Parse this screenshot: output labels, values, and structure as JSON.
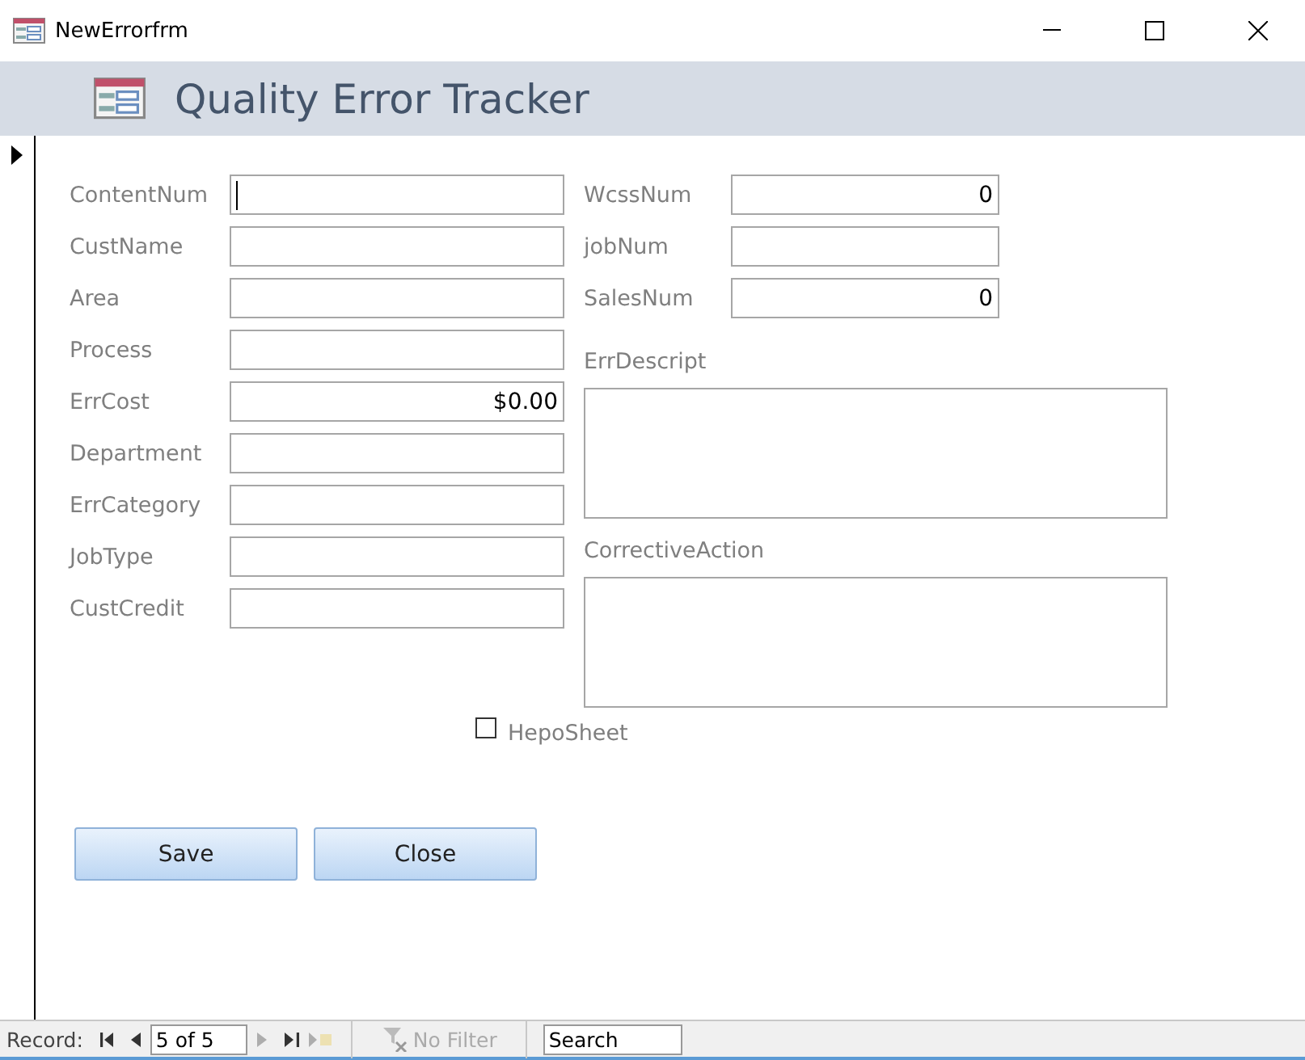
{
  "window": {
    "title": "NewErrorfrm"
  },
  "header": {
    "title": "Quality Error Tracker"
  },
  "record_selector": {
    "current": true
  },
  "left_fields": [
    {
      "label": "ContentNum",
      "kind": "text",
      "focused": true
    },
    {
      "label": "CustName",
      "kind": "text",
      "focused": false
    },
    {
      "label": "Area",
      "kind": "text",
      "focused": false
    },
    {
      "label": "Process",
      "kind": "text",
      "focused": false
    },
    {
      "label": "ErrCost",
      "value": "$0.00",
      "kind": "number",
      "focused": false
    },
    {
      "label": "Department",
      "kind": "text",
      "focused": false
    },
    {
      "label": "ErrCategory",
      "kind": "text",
      "focused": false
    },
    {
      "label": "JobType",
      "kind": "text",
      "focused": false
    },
    {
      "label": "CustCredit",
      "kind": "text",
      "focused": false
    }
  ],
  "right_fields": [
    {
      "label": "WcssNum",
      "value": "0",
      "kind": "number",
      "focused": false
    },
    {
      "label": "jobNum",
      "kind": "text",
      "focused": false
    },
    {
      "label": "SalesNum",
      "value": "0",
      "kind": "number",
      "focused": false
    }
  ],
  "memos": [
    {
      "label": "ErrDescript"
    },
    {
      "label": "CorrectiveAction"
    }
  ],
  "checkbox": {
    "label": "HepoSheet",
    "checked": false
  },
  "buttons": [
    "Save",
    "Close"
  ],
  "navigation": {
    "label": "Record:",
    "position": "5 of 5",
    "filter": "No Filter",
    "search": "Search",
    "controls": [
      {
        "kind": "first",
        "disabled": false
      },
      {
        "kind": "prev",
        "disabled": false
      },
      {
        "kind": "next",
        "disabled": true
      },
      {
        "kind": "last",
        "disabled": false
      },
      {
        "kind": "new",
        "disabled": true
      }
    ]
  }
}
